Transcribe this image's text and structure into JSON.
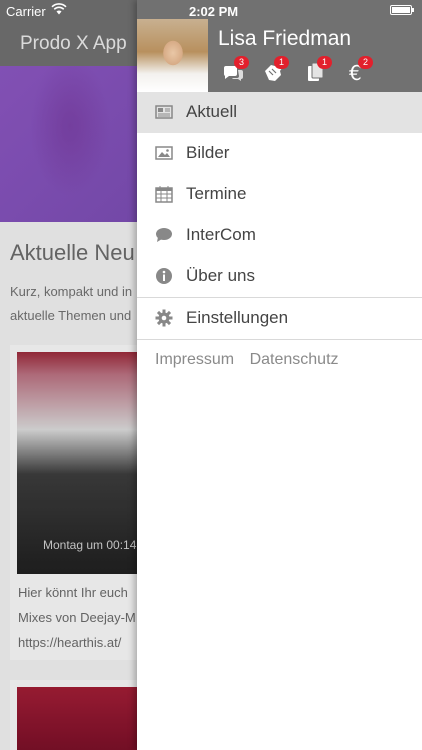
{
  "status_bar": {
    "carrier": "Carrier",
    "time": "2:02 PM"
  },
  "background": {
    "nav_title": "Prodo X App",
    "heading": "Aktuelle Neu",
    "paragraph_line1": "Kurz, kompakt und in",
    "paragraph_line2": "aktuelle Themen und",
    "photo_caption": "Montag um 00:14",
    "card_text_line1": "Hier könnt Ihr euch",
    "card_text_line2": "Mixes von Deejay-M",
    "card_text_line3": "https://hearthis.at/"
  },
  "drawer": {
    "user_name": "Lisa Friedman",
    "badges": [
      {
        "icon": "chat-bubbles-icon",
        "count": "3"
      },
      {
        "icon": "hand-icon",
        "count": "1"
      },
      {
        "icon": "documents-icon",
        "count": "1"
      },
      {
        "icon": "euro-icon",
        "count": "2"
      }
    ],
    "menu": [
      {
        "label": "Aktuell",
        "icon": "newspaper-icon",
        "active": true
      },
      {
        "label": "Bilder",
        "icon": "image-icon"
      },
      {
        "label": "Termine",
        "icon": "calendar-icon"
      },
      {
        "label": "InterCom",
        "icon": "chat-bubble-icon"
      },
      {
        "label": "Über uns",
        "icon": "info-icon"
      }
    ],
    "settings_label": "Einstellungen",
    "footer": {
      "impressum": "Impressum",
      "datenschutz": "Datenschutz"
    }
  },
  "colors": {
    "header_bg": "#717171",
    "badge_red": "#e2202c",
    "active_row": "#e3e3e3"
  }
}
